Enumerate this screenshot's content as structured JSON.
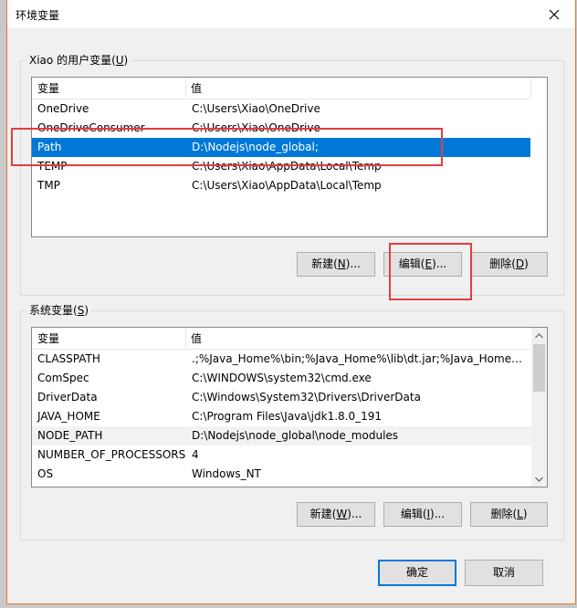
{
  "window": {
    "title": "环境变量"
  },
  "user_vars": {
    "legend_prefix": "Xiao 的用户变量(",
    "legend_key": "U",
    "legend_suffix": ")",
    "col_name": "变量",
    "col_value": "值",
    "rows": [
      {
        "name": "OneDrive",
        "value": "C:\\Users\\Xiao\\OneDrive"
      },
      {
        "name": "OneDriveConsumer",
        "value": "C:\\Users\\Xiao\\OneDrive"
      },
      {
        "name": "Path",
        "value": "D:\\Nodejs\\node_global;"
      },
      {
        "name": "TEMP",
        "value": "C:\\Users\\Xiao\\AppData\\Local\\Temp"
      },
      {
        "name": "TMP",
        "value": "C:\\Users\\Xiao\\AppData\\Local\\Temp"
      }
    ],
    "selected_index": 2,
    "buttons": {
      "new": {
        "label": "新建(",
        "key": "N",
        "suffix": ")..."
      },
      "edit": {
        "label": "编辑(",
        "key": "E",
        "suffix": ")..."
      },
      "delete": {
        "label": "删除(",
        "key": "D",
        "suffix": ")"
      }
    }
  },
  "system_vars": {
    "legend_prefix": "系统变量(",
    "legend_key": "S",
    "legend_suffix": ")",
    "col_name": "变量",
    "col_value": "值",
    "rows": [
      {
        "name": "CLASSPATH",
        "value": ".;%Java_Home%\\bin;%Java_Home%\\lib\\dt.jar;%Java_Home%\\..."
      },
      {
        "name": "ComSpec",
        "value": "C:\\WINDOWS\\system32\\cmd.exe"
      },
      {
        "name": "DriverData",
        "value": "C:\\Windows\\System32\\Drivers\\DriverData"
      },
      {
        "name": "JAVA_HOME",
        "value": "C:\\Program Files\\Java\\jdk1.8.0_191"
      },
      {
        "name": "NODE_PATH",
        "value": "D:\\Nodejs\\node_global\\node_modules"
      },
      {
        "name": "NUMBER_OF_PROCESSORS",
        "value": "4"
      },
      {
        "name": "OS",
        "value": "Windows_NT"
      }
    ],
    "hover_index": 4,
    "buttons": {
      "new": {
        "label": "新建(",
        "key": "W",
        "suffix": ")..."
      },
      "edit": {
        "label": "编辑(",
        "key": "I",
        "suffix": ")..."
      },
      "delete": {
        "label": "删除(",
        "key": "L",
        "suffix": ")"
      }
    }
  },
  "footer": {
    "ok": "确定",
    "cancel": "取消"
  },
  "colors": {
    "selection": "#0078d7",
    "annotation_red": "#e0403e",
    "window_border": "#e8782a"
  },
  "icons": {
    "close": "close-icon",
    "scroll_up": "chevron-up-icon",
    "scroll_down": "chevron-down-icon"
  }
}
